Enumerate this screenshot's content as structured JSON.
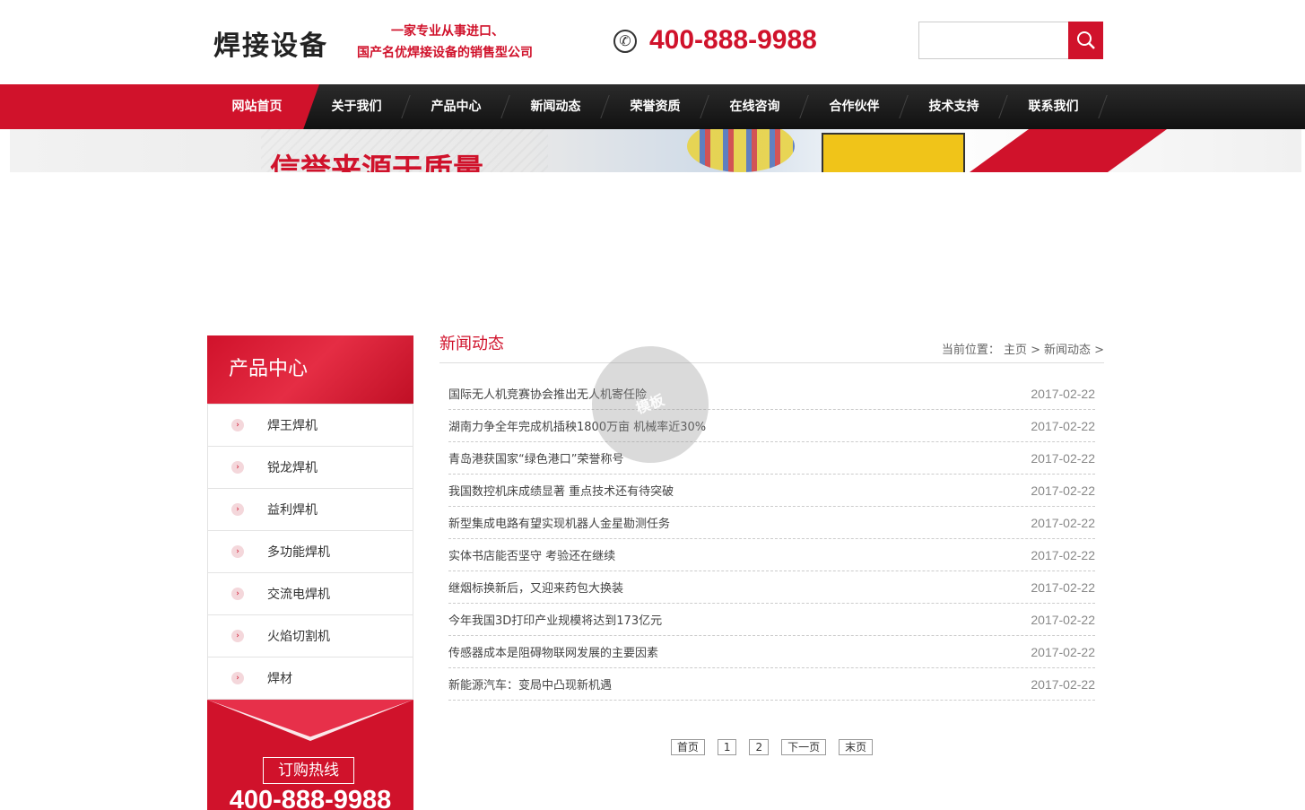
{
  "header": {
    "logo_text": "焊接设备",
    "slogan_line1": "一家专业从事进口、",
    "slogan_line2": "国产名优焊接设备的销售型公司",
    "phone": "400-888-9988",
    "search_placeholder": ""
  },
  "nav": {
    "items": [
      {
        "label": "网站首页"
      },
      {
        "label": "关于我们"
      },
      {
        "label": "产品中心"
      },
      {
        "label": "新闻动态"
      },
      {
        "label": "荣誉资质"
      },
      {
        "label": "在线咨询"
      },
      {
        "label": "合作伙伴"
      },
      {
        "label": "技术支持"
      },
      {
        "label": "联系我们"
      }
    ]
  },
  "banner": {
    "text": "信誉来源于质量"
  },
  "sidebar": {
    "title": "产品中心",
    "items": [
      {
        "label": "焊王焊机"
      },
      {
        "label": "锐龙焊机"
      },
      {
        "label": "益利焊机"
      },
      {
        "label": "多功能焊机"
      },
      {
        "label": "交流电焊机"
      },
      {
        "label": "火焰切割机"
      },
      {
        "label": "焊材"
      }
    ],
    "hotline_label": "订购热线",
    "hotline_number": "400-888-9988"
  },
  "main": {
    "title": "新闻动态",
    "breadcrumb": {
      "prefix": "当前位置：",
      "home": "主页 >",
      "current": "新闻动态 >"
    },
    "news": [
      {
        "title": "国际无人机竞赛协会推出无人机寄任险",
        "date": "2017-02-22"
      },
      {
        "title": "湖南力争全年完成机插秧1800万亩 机械率近30%",
        "date": "2017-02-22"
      },
      {
        "title": "青岛港获国家“绿色港口”荣誉称号",
        "date": "2017-02-22"
      },
      {
        "title": "我国数控机床成绩显著 重点技术还有待突破",
        "date": "2017-02-22"
      },
      {
        "title": "新型集成电路有望实现机器人金星勘测任务",
        "date": "2017-02-22"
      },
      {
        "title": "实体书店能否坚守 考验还在继续",
        "date": "2017-02-22"
      },
      {
        "title": "继烟标换新后，又迎来药包大换装",
        "date": "2017-02-22"
      },
      {
        "title": "今年我国3D打印产业规模将达到173亿元",
        "date": "2017-02-22"
      },
      {
        "title": "传感器成本是阻碍物联网发展的主要因素",
        "date": "2017-02-22"
      },
      {
        "title": "新能源汽车：变局中凸现新机遇",
        "date": "2017-02-22"
      }
    ],
    "pager": {
      "first": "首页",
      "page1": "1",
      "page2": "2",
      "next": "下一页",
      "last": "末页"
    }
  },
  "watermark": "模板",
  "colors": {
    "accent": "#d0122b",
    "nav_bg": "#1a1a1a"
  }
}
